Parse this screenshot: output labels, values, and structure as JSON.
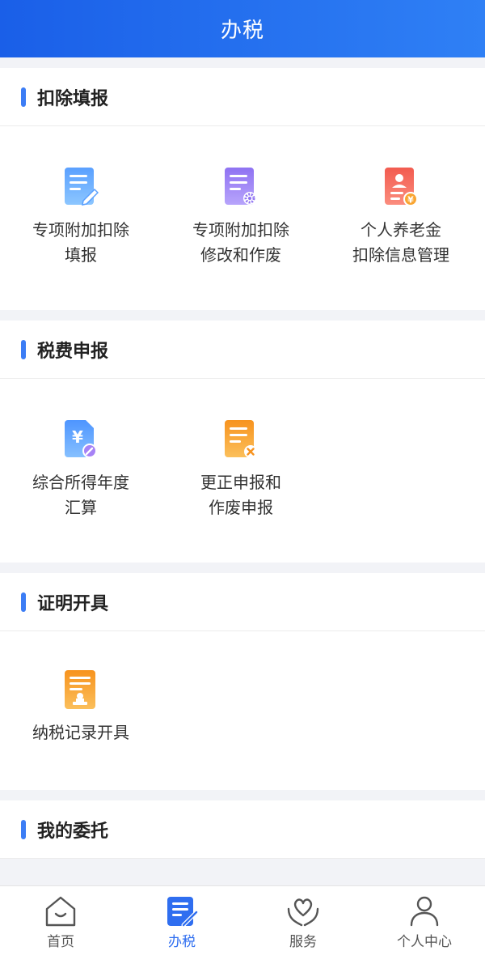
{
  "header": {
    "title": "办税"
  },
  "sections": [
    {
      "title": "扣除填报",
      "items": [
        {
          "label": [
            "专项附加扣除",
            "填报"
          ],
          "icon": "document-edit-icon"
        },
        {
          "label": [
            "专项附加扣除",
            "修改和作废"
          ],
          "icon": "document-gear-icon"
        },
        {
          "label": [
            "个人养老金",
            "扣除信息管理"
          ],
          "icon": "pension-card-icon"
        }
      ]
    },
    {
      "title": "税费申报",
      "items": [
        {
          "label": [
            "综合所得年度",
            "汇算"
          ],
          "icon": "yuan-document-icon"
        },
        {
          "label": [
            "更正申报和",
            "作废申报"
          ],
          "icon": "document-cancel-icon"
        }
      ]
    },
    {
      "title": "证明开具",
      "items": [
        {
          "label": [
            "纳税记录开具"
          ],
          "icon": "stamp-document-icon"
        }
      ]
    },
    {
      "title": "我的委托",
      "items": []
    }
  ],
  "tabbar": {
    "items": [
      {
        "label": "首页",
        "icon": "home-icon",
        "active": false
      },
      {
        "label": "办税",
        "icon": "tax-edit-icon",
        "active": true
      },
      {
        "label": "服务",
        "icon": "heart-hands-icon",
        "active": false
      },
      {
        "label": "个人中心",
        "icon": "person-icon",
        "active": false
      }
    ]
  },
  "colors": {
    "primary": "#2f6ef0",
    "header_start": "#1a5fe8",
    "header_end": "#2f80f5",
    "background": "#f2f3f7"
  }
}
